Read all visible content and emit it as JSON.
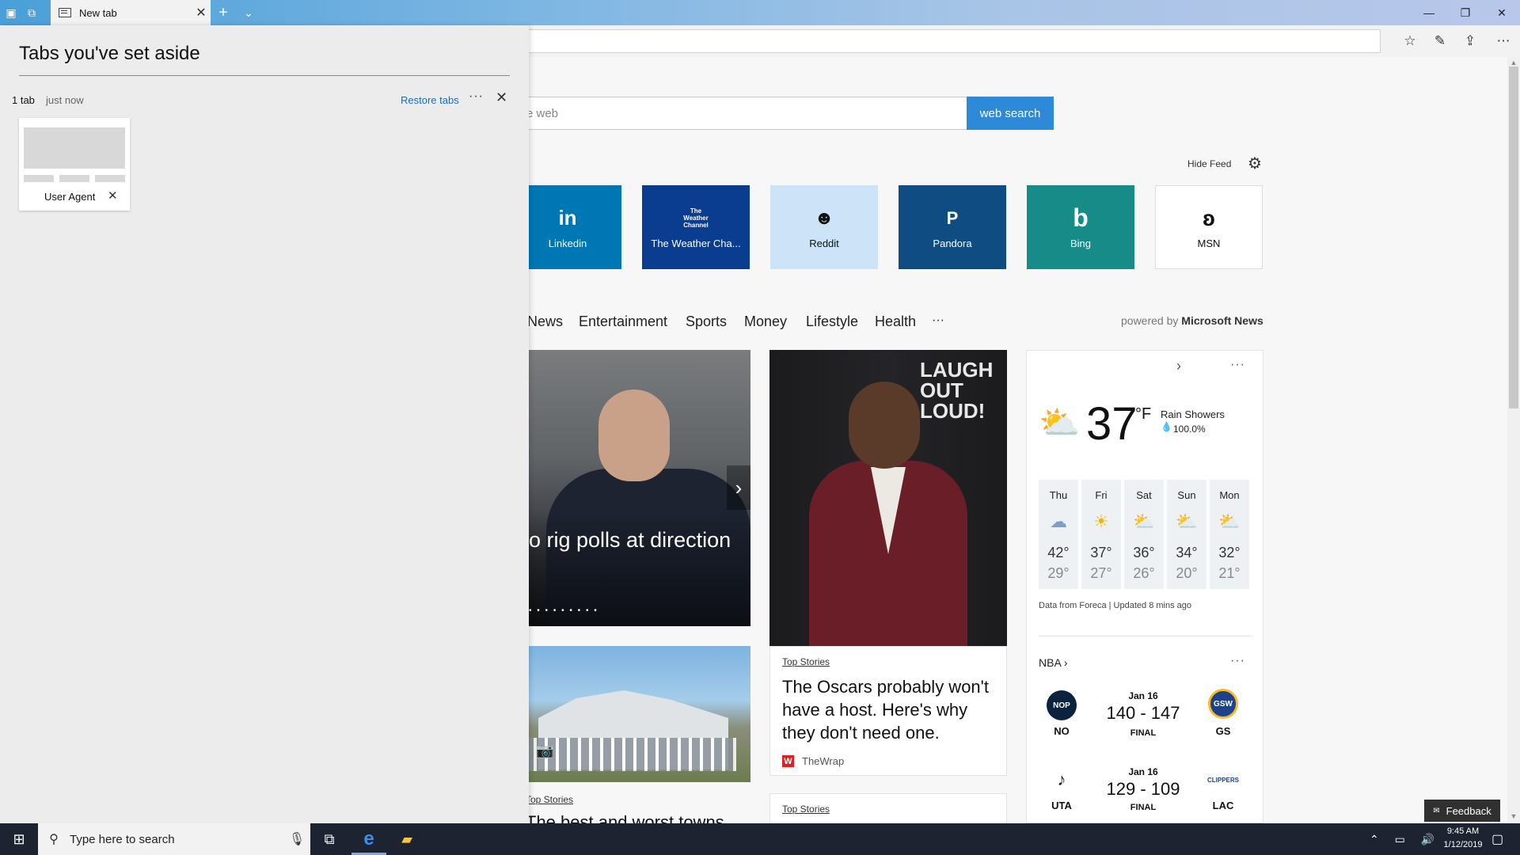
{
  "titlebar": {
    "active_tab_title": "New tab",
    "icons": [
      "set-aside-tabs-icon",
      "tab-preview-icon",
      "new-tab-icon",
      "tab-list-icon"
    ]
  },
  "window": {
    "buttons": [
      "minimize",
      "maximize",
      "close"
    ]
  },
  "toolbar": {
    "icons": [
      "favorites-icon",
      "pen-icon",
      "share-icon",
      "more-icon"
    ]
  },
  "search": {
    "placeholder_visible": "e web",
    "button_label": "web search"
  },
  "feed": {
    "hide_label": "Hide Feed"
  },
  "tiles": [
    {
      "label": "Linkedin",
      "glyph": "in",
      "color": "#0077b5"
    },
    {
      "label": "The Weather Cha...",
      "glyph": "The Weather Channel",
      "color": "#0a3d8f"
    },
    {
      "label": "Reddit",
      "glyph": "reddit-alien",
      "color": "#cde3f8"
    },
    {
      "label": "Pandora",
      "glyph": "P",
      "color": "#0f4c81"
    },
    {
      "label": "Bing",
      "glyph": "b",
      "color": "#168b87"
    },
    {
      "label": "MSN",
      "glyph": "msn-butterfly",
      "color": "#ffffff"
    }
  ],
  "nav": {
    "items": [
      "News",
      "Entertainment",
      "Sports",
      "Money",
      "Lifestyle",
      "Health"
    ],
    "more": "···",
    "powered_prefix": "powered by",
    "powered_brand": "Microsoft News"
  },
  "news": {
    "hero_headline": "o rig polls at direction",
    "hero_dots": "• • • • • • • • •",
    "oscars": {
      "tag": "Top Stories",
      "title": "The Oscars probably won't have a host. Here's why they don't need one.",
      "source_logo": "W",
      "source": "TheWrap"
    },
    "card2_tag": "Top Stories",
    "left_tag": "Top Stories",
    "left_title": "The best and worst towns"
  },
  "weather": {
    "temp": "37",
    "unit": "°F",
    "condition": "Rain Showers",
    "precip": "100.0%",
    "forecast": [
      {
        "day": "Thu",
        "hi": "42°",
        "lo": "29°",
        "icon": "rain-cloud-icon"
      },
      {
        "day": "Fri",
        "hi": "37°",
        "lo": "27°",
        "icon": "sun-icon"
      },
      {
        "day": "Sat",
        "hi": "36°",
        "lo": "26°",
        "icon": "partly-cloudy-icon"
      },
      {
        "day": "Sun",
        "hi": "34°",
        "lo": "20°",
        "icon": "partly-cloudy-icon"
      },
      {
        "day": "Mon",
        "hi": "32°",
        "lo": "21°",
        "icon": "partly-cloudy-icon"
      }
    ],
    "source": "Data from Foreca | Updated 8 mins ago"
  },
  "nba": {
    "title": "NBA",
    "games": [
      {
        "date": "Jan 16",
        "score": "140 - 147",
        "status": "FINAL",
        "home": "NO",
        "away": "GS"
      },
      {
        "date": "Jan 16",
        "score": "129 - 109",
        "status": "FINAL",
        "home": "UTA",
        "away": "LAC"
      }
    ]
  },
  "feedback": {
    "label": "Feedback"
  },
  "aside": {
    "title": "Tabs you've set aside",
    "count": "1 tab",
    "time": "just now",
    "restore": "Restore tabs",
    "more": "···",
    "item_title": "User Agent"
  },
  "taskbar": {
    "search_placeholder": "Type here to search",
    "time": "9:45 AM",
    "date": "1/12/2019"
  }
}
